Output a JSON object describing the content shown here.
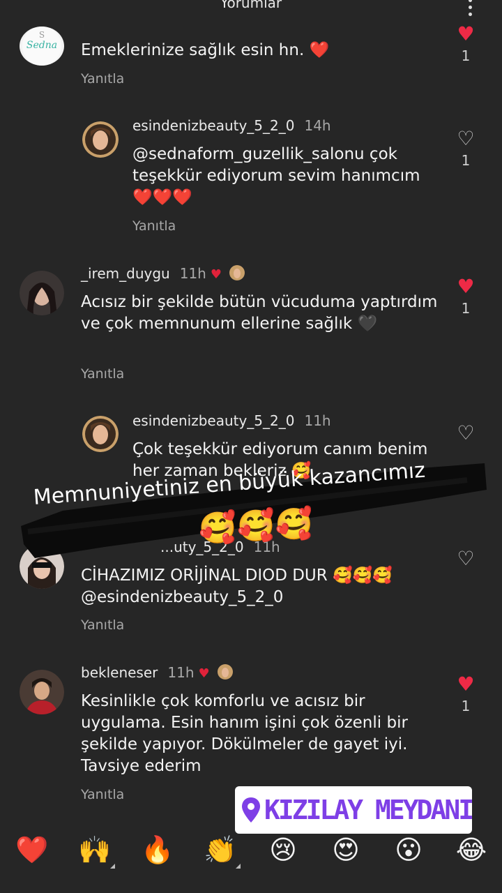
{
  "header": {
    "title": "Yorumlar"
  },
  "comments": [
    {
      "text": "Emeklerinize sağlık esin hn. ❤️",
      "reply": "Yanıtla",
      "likes": "1",
      "liked": true,
      "avatar_text": "Sedna"
    },
    {
      "username": "esindenizbeauty_5_2_0",
      "time": "14h",
      "text": "@sednaform_guzellik_salonu çok teşekkür ediyorum sevim hanımcım ❤️❤️❤️",
      "reply": "Yanıtla",
      "likes": "1",
      "liked": false
    },
    {
      "username": "_irem_duygu",
      "time": "11h",
      "text": "Acısız bir şekilde bütün vücuduma yaptırdım ve çok memnunum ellerine sağlık 🖤",
      "reply": "Yanıtla",
      "likes": "1",
      "liked": true
    },
    {
      "username": "esindenizbeauty_5_2_0",
      "time": "11h",
      "text": "Çok teşekkür ediyorum canım benim her zaman bekleriz 🥰",
      "liked": false
    },
    {
      "username": "...uty_5_2_0",
      "time": "11h",
      "text": "CİHAZIMIZ ORİJİNAL DIOD DUR 🥰🥰🥰 @esindenizbeauty_5_2_0",
      "reply": "Yanıtla",
      "liked": false
    },
    {
      "username": "bekleneser",
      "time": "11h",
      "text": "Kesinlikle çok komforlu ve acısız bir uygulama. Esin hanım işini çok özenli bir şekilde yapıyor. Dökülmeler de gayet iyi. Tavsiye ederim",
      "reply": "Yanıtla",
      "likes": "1",
      "liked": true
    }
  ],
  "banner": {
    "text": "Memnuniyetiniz en büyük kazancımız",
    "emojis": "🥰🥰🥰"
  },
  "location": {
    "label": "KIZILAY MEYDANI"
  },
  "emoji_bar": [
    "❤️",
    "🙌",
    "🔥",
    "👏",
    "😢",
    "😍",
    "😮",
    "😂"
  ],
  "colors": {
    "background": "#262626",
    "like_red": "#ee2a46",
    "location_purple": "#7e3fe6"
  }
}
